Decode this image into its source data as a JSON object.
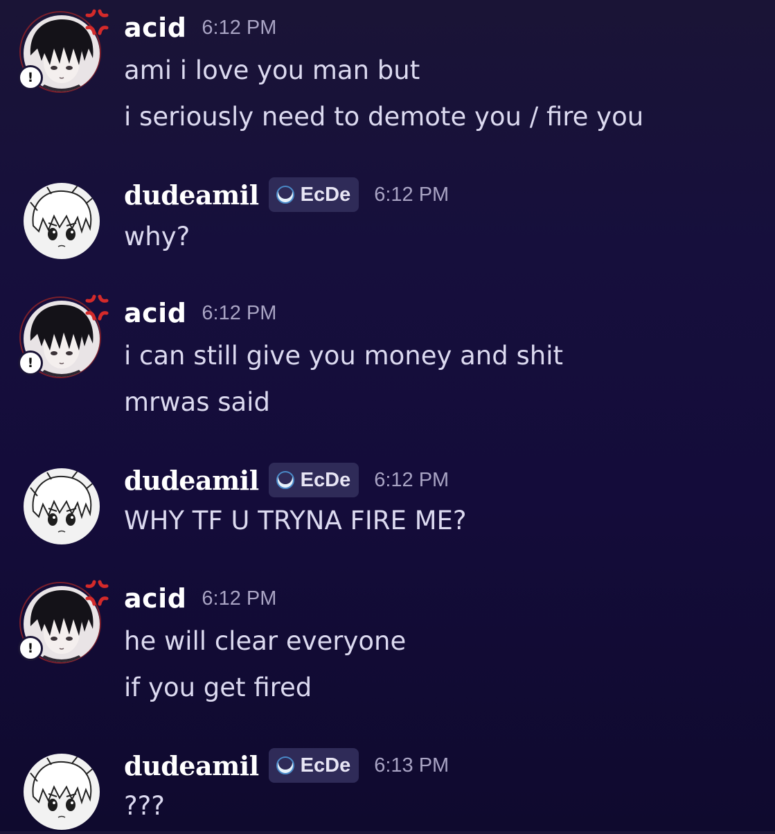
{
  "messages": [
    {
      "author": "acid",
      "time": "6:12 PM",
      "avatar": "acid-avatar",
      "lines": [
        "ami i love you man but",
        "i seriously need to demote you / fire you"
      ]
    },
    {
      "author": "dudeamil",
      "tag": "EcDe",
      "time": "6:12 PM",
      "avatar": "dudeamil-avatar",
      "lines": [
        "why?"
      ]
    },
    {
      "author": "acid",
      "time": "6:12 PM",
      "avatar": "acid-avatar",
      "lines": [
        "i can still give you money and shit",
        "mrwas said"
      ]
    },
    {
      "author": "dudeamil",
      "tag": "EcDe",
      "time": "6:12 PM",
      "avatar": "dudeamil-avatar",
      "lines": [
        "WHY TF U TRYNA FIRE ME?"
      ]
    },
    {
      "author": "acid",
      "time": "6:12 PM",
      "avatar": "acid-avatar",
      "lines": [
        "he will clear everyone",
        "if you get fired"
      ]
    },
    {
      "author": "dudeamil",
      "tag": "EcDe",
      "time": "6:13 PM",
      "avatar": "dudeamil-avatar",
      "lines": [
        "???"
      ]
    }
  ],
  "icons": {
    "alert": "exclamation-icon",
    "anger": "anger-mark-icon",
    "tag": "crescent-icon"
  },
  "badge_text": "!",
  "colors": {
    "background": "#140c3a",
    "username": "#ffffff",
    "message_text": "#dcdaf0",
    "timestamp": "#a9a4c4",
    "tag_background": "#2f2b58",
    "avatar_ring": "#7a1f2b"
  }
}
